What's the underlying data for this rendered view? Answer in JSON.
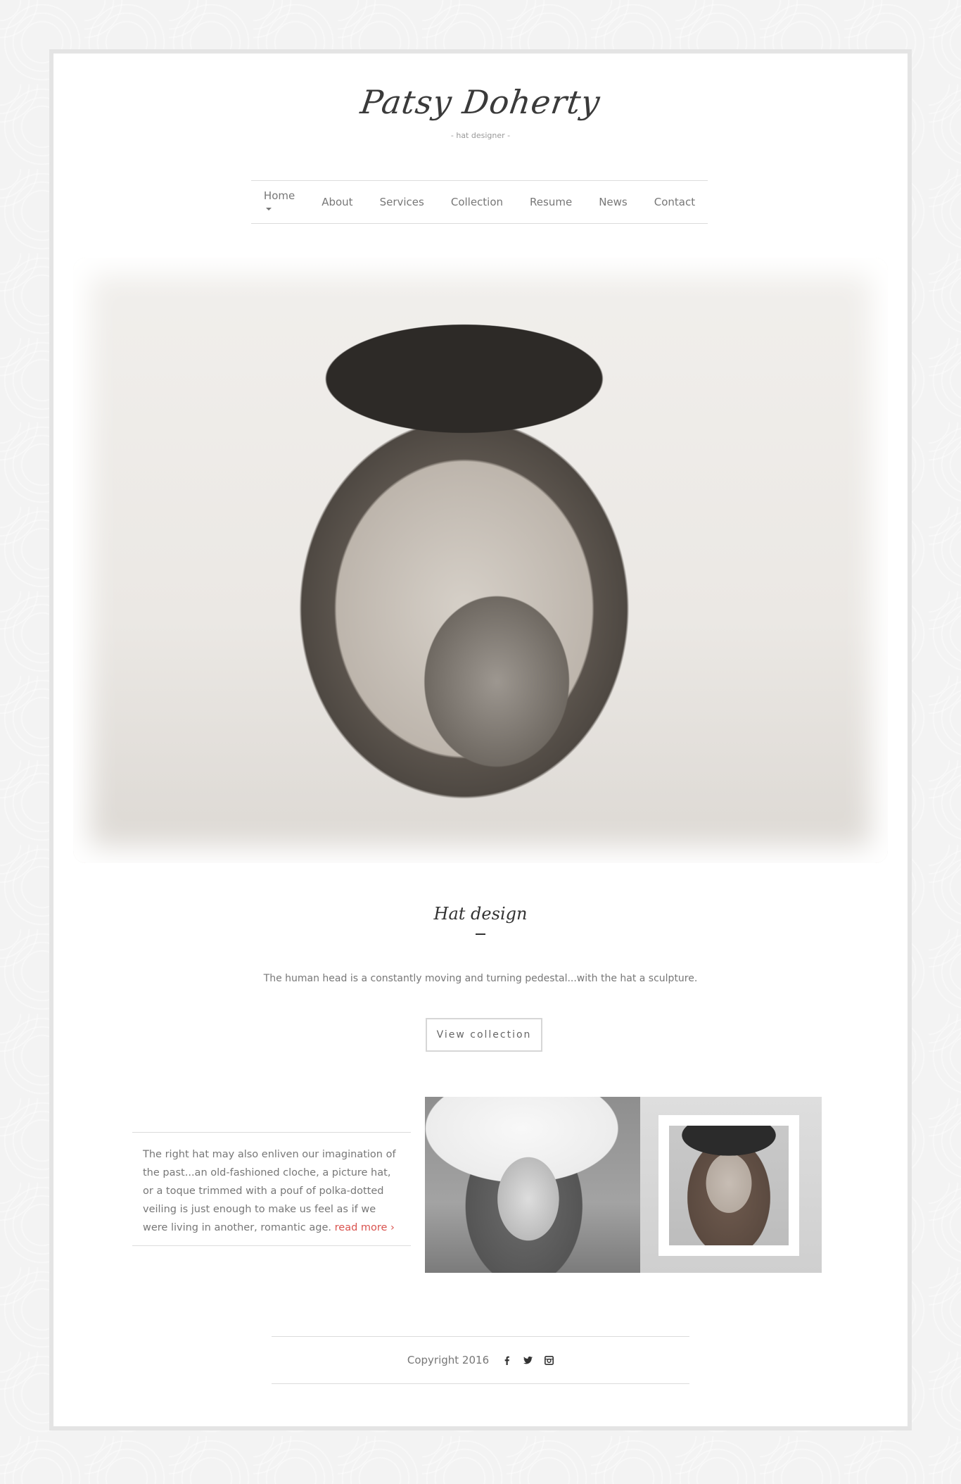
{
  "brand": {
    "name": "Patsy Doherty",
    "tagline": "- hat designer -"
  },
  "nav": {
    "items": [
      {
        "label": "Home",
        "icon": "caret-down-icon"
      },
      {
        "label": "About"
      },
      {
        "label": "Services"
      },
      {
        "label": "Collection"
      },
      {
        "label": "Resume"
      },
      {
        "label": "News"
      },
      {
        "label": "Contact"
      }
    ]
  },
  "intro": {
    "title": "Hat design",
    "text": "The human head is a constantly moving and turning pedestal...with the hat a sculpture.",
    "button_label": "View collection"
  },
  "feature": {
    "text": "The right hat may also enliven our imagination of the past...an old-fashioned cloche, a picture hat, or a toque trimmed with a pouf of polka-dotted veiling is just enough to make us feel as if we were living in another, romantic age.",
    "link_label": "read more ›"
  },
  "footer": {
    "copyright": "Copyright 2016",
    "social": [
      "facebook-icon",
      "twitter-icon",
      "instagram-icon"
    ]
  },
  "colors": {
    "accent": "#d9534f",
    "text": "#777777",
    "border": "#dcdcdc"
  }
}
